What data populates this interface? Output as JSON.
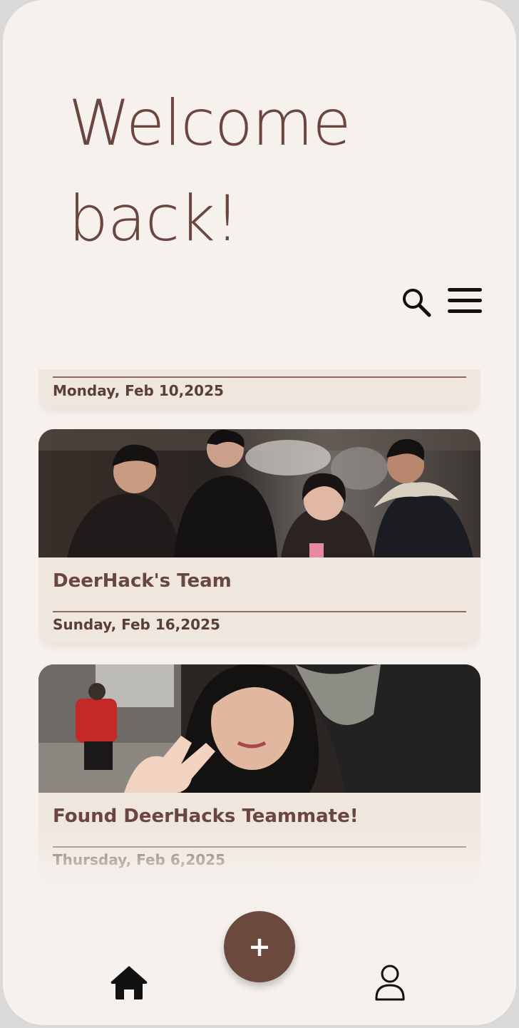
{
  "header": {
    "welcome_text": "Welcome back!"
  },
  "toolbar": {
    "search_icon": "search-icon",
    "menu_icon": "hamburger-menu-icon"
  },
  "feed": {
    "cards": [
      {
        "title": "",
        "date": "Monday, Feb 10,2025",
        "photo": "partial-cropped-card"
      },
      {
        "title": "DeerHack's Team",
        "date": "Sunday, Feb 16,2025",
        "photo": "group-photo-four-people-snow"
      },
      {
        "title": "Found DeerHacks Teammate!",
        "date": "Thursday, Feb 6,2025",
        "photo": "selfie-peace-sign-night"
      }
    ]
  },
  "fab": {
    "label": "+"
  },
  "bottom_nav": {
    "home_icon": "home-icon",
    "profile_icon": "profile-icon"
  },
  "colors": {
    "background": "#f6f1ed",
    "card": "#efe6de",
    "accent": "#6b4a3d",
    "text": "#6b4640"
  }
}
